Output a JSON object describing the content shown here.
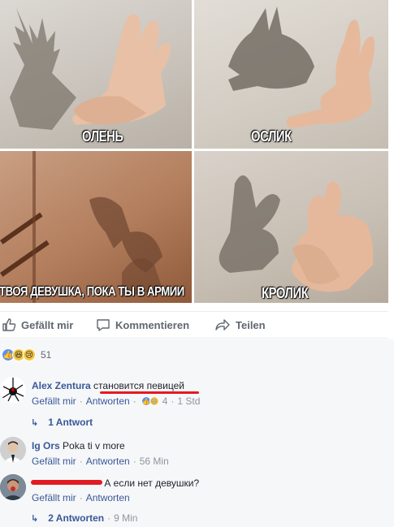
{
  "image": {
    "captions": [
      "ОЛЕНЬ",
      "ОСЛИК",
      "ТВОЯ ДЕВУШКА, ПОКА ТЫ В АРМИИ",
      "КРОЛИК"
    ]
  },
  "actions": {
    "like": "Gefällt mir",
    "comment": "Kommentieren",
    "share": "Teilen"
  },
  "reactions": {
    "count": "51"
  },
  "comments": [
    {
      "author": "Alex Zentura",
      "text": "становится певицей",
      "like": "Gefällt mir",
      "reply": "Antworten",
      "reaction_count": "4",
      "time": "1 Std",
      "replies_label": "1 Antwort"
    },
    {
      "author": "Ig Ors",
      "text": "Poka ti v more",
      "like": "Gefällt mir",
      "reply": "Antworten",
      "time": "56 Min"
    },
    {
      "author": "",
      "text": "А если нет девушки?",
      "like": "Gefällt mir",
      "reply": "Antworten",
      "replies_label": "2 Antworten",
      "replies_time": "9 Min"
    }
  ],
  "separator": "·",
  "colors": {
    "link": "#385898",
    "meta": "#90949c",
    "redaction": "#e31b23",
    "comments_bg": "#f6f7f9"
  }
}
